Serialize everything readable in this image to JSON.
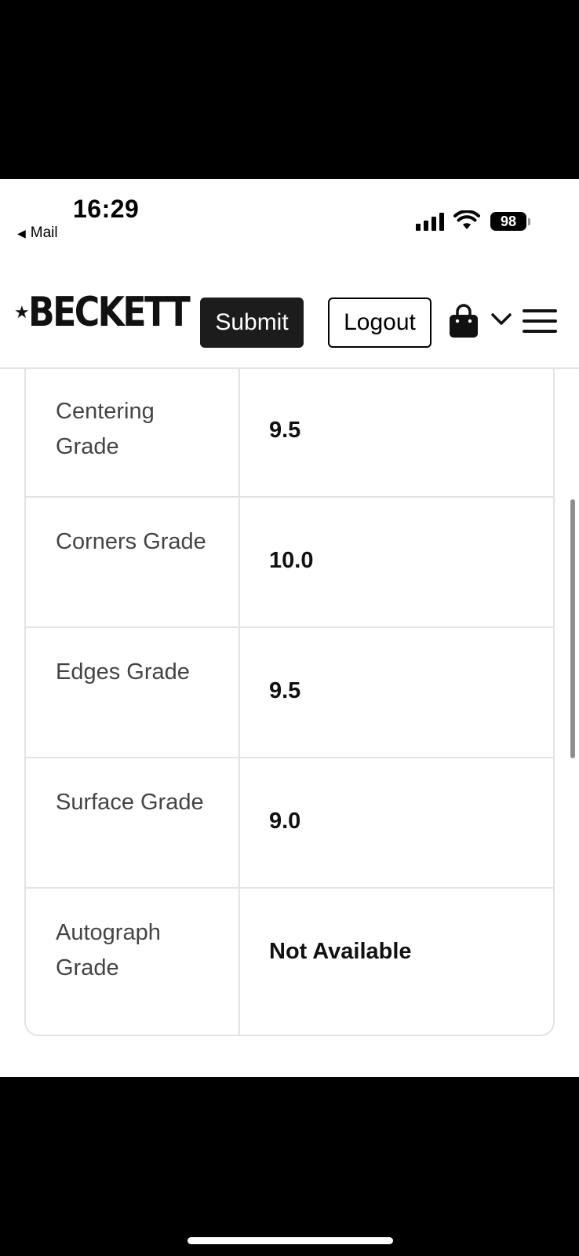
{
  "status_bar": {
    "time": "16:29",
    "back_app": "Mail",
    "battery": "98"
  },
  "header": {
    "logo": "BECKETT",
    "submit_label": "Submit",
    "logout_label": "Logout",
    "icons": [
      "cart-icon",
      "chevron-down-icon",
      "hamburger-menu-icon"
    ]
  },
  "grades": [
    {
      "label": "Centering Grade",
      "value": "9.5"
    },
    {
      "label": "Corners Grade",
      "value": "10.0"
    },
    {
      "label": "Edges Grade",
      "value": "9.5"
    },
    {
      "label": "Surface Grade",
      "value": "9.0"
    },
    {
      "label": "Autograph Grade",
      "value": "Not Available"
    }
  ]
}
